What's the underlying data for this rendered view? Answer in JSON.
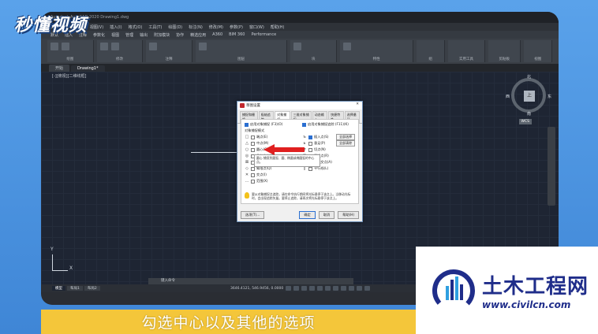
{
  "watermark": "秒懂视频",
  "app": {
    "title": "Autodesk AutoCAD 2020  Drawing1.dwg",
    "menus": [
      "文件(F)",
      "编辑(E)",
      "视图(V)",
      "插入(I)",
      "格式(O)",
      "工具(T)",
      "绘图(D)",
      "标注(N)",
      "修改(M)",
      "参数(P)",
      "窗口(W)",
      "帮助(H)"
    ],
    "ribbon_tabs": [
      "默认",
      "插入",
      "注释",
      "参数化",
      "视图",
      "管理",
      "输出",
      "附加模块",
      "协作",
      "精选应用",
      "A360",
      "BIM 360",
      "Performance"
    ],
    "ribbon_panels": [
      "绘图",
      "修改",
      "注释",
      "图层",
      "块",
      "特性",
      "组",
      "实用工具",
      "剪贴板",
      "视图"
    ],
    "doc_tabs": [
      "开始",
      "Drawing1*"
    ],
    "view_label": "[-][俯视][二维线框]",
    "command_placeholder": "键入命令",
    "layout_tabs": [
      "模型",
      "布局1",
      "布局2"
    ],
    "coords": "3646.4121, 546.9456, 0.0000",
    "ucs_x": "X",
    "ucs_y": "Y"
  },
  "viewcube": {
    "north": "北",
    "south": "南",
    "west": "西",
    "east": "东",
    "top": "上",
    "wcs": "WCS"
  },
  "dialog": {
    "title": "草图设置",
    "tabs": [
      "捕捉和栅格",
      "极轴追踪",
      "对象捕捉",
      "三维对象捕捉",
      "动态输入",
      "快捷特性",
      "选择循环"
    ],
    "active_tab": "对象捕捉",
    "enable_osnap": "启用对象捕捉 (F3)(O)",
    "enable_tracking": "启用对象捕捉追踪 (F11)(K)",
    "group_label": "对象捕捉模式",
    "select_all": "全部选择",
    "clear_all": "全部清除",
    "tooltip": "圆心 捕捉到圆弧、圆、椭圆或椭圆弧的中心点。",
    "left_modes": [
      {
        "sym": "□",
        "label": "端点(E)",
        "checked": false
      },
      {
        "sym": "△",
        "label": "中点(M)",
        "checked": false
      },
      {
        "sym": "○",
        "label": "圆心(C)",
        "checked": false
      },
      {
        "sym": "◎",
        "label": "几何中心(G)",
        "checked": false
      },
      {
        "sym": "⊠",
        "label": "节点(D)",
        "checked": false
      },
      {
        "sym": "◇",
        "label": "象限点(Q)",
        "checked": false
      },
      {
        "sym": "✕",
        "label": "交点(I)",
        "checked": false
      },
      {
        "sym": "…",
        "label": "范围(X)",
        "checked": false
      }
    ],
    "right_modes": [
      {
        "sym": "ъ",
        "label": "插入点(S)",
        "checked": true
      },
      {
        "sym": "ь",
        "label": "垂足(P)",
        "checked": false
      },
      {
        "sym": "σ",
        "label": "切点(N)",
        "checked": false
      },
      {
        "sym": "⊠",
        "label": "最近点(R)",
        "checked": false
      },
      {
        "sym": "⊠",
        "label": "外观交点(A)",
        "checked": false
      },
      {
        "sym": "∥",
        "label": "平行线(L)",
        "checked": false
      }
    ],
    "note": "要从对象捕捉点追踪，请在命令执行期间将光标悬停于该点上。当移动光标时，会出现追踪矢量。要停止追踪，请再次将光标悬停于该点上。",
    "options_button": "选项(T)...",
    "ok_button": "确定",
    "cancel_button": "取消",
    "help_button": "帮助(H)"
  },
  "subtitle": "勾选中心以及其他的选项",
  "logo": {
    "name": "土木工程网",
    "url": "www.civilcn.com"
  }
}
